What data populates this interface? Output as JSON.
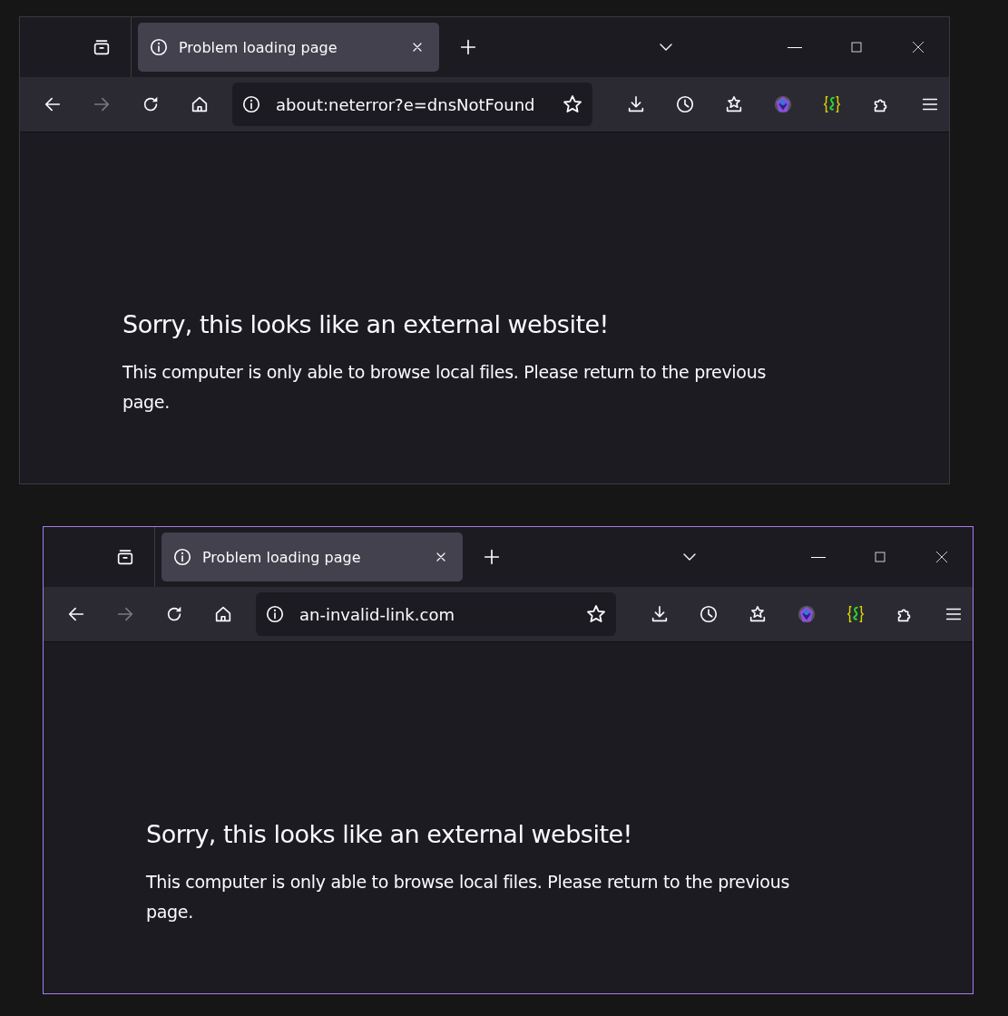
{
  "windows": [
    {
      "focused": false,
      "tab": {
        "title": "Problem loading page",
        "selected": true
      },
      "forward_button": {
        "disabled": true
      },
      "url": "about:neterror?e=dnsNotFound",
      "heading": "Sorry, this looks like an external website!",
      "message": "This computer is only able to browse local files. Please return to the previous page."
    },
    {
      "focused": true,
      "tab": {
        "title": "Problem loading page",
        "selected": true
      },
      "forward_button": {
        "disabled": true
      },
      "url": "an-invalid-link.com",
      "heading": "Sorry, this looks like an external website!",
      "message": "This computer is only able to browse local files. Please return to the previous page."
    }
  ]
}
